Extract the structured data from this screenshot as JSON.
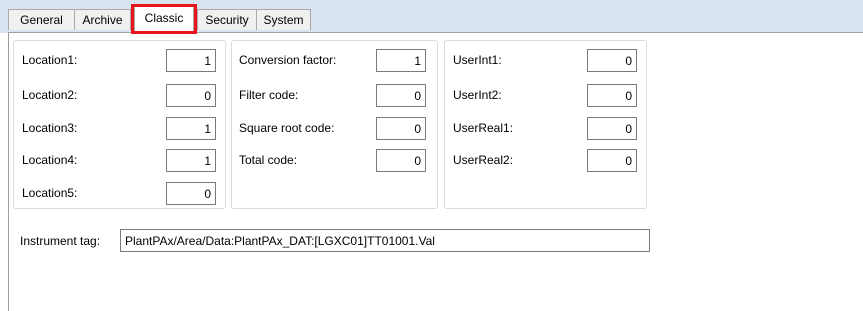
{
  "tabs": [
    {
      "label": "General"
    },
    {
      "label": "Archive"
    },
    {
      "label": "Classic"
    },
    {
      "label": "Security"
    },
    {
      "label": "System"
    }
  ],
  "active_tab": "Classic",
  "highlight_color": "#e8141c",
  "locations": [
    {
      "label": "Location1:",
      "value": "1"
    },
    {
      "label": "Location2:",
      "value": "0"
    },
    {
      "label": "Location3:",
      "value": "1"
    },
    {
      "label": "Location4:",
      "value": "1"
    },
    {
      "label": "Location5:",
      "value": "0"
    }
  ],
  "codes": [
    {
      "label": "Conversion factor:",
      "value": "1"
    },
    {
      "label": "Filter code:",
      "value": "0"
    },
    {
      "label": "Square root code:",
      "value": "0"
    },
    {
      "label": "Total code:",
      "value": "0"
    }
  ],
  "user": [
    {
      "label": "UserInt1:",
      "value": "0"
    },
    {
      "label": "UserInt2:",
      "value": "0"
    },
    {
      "label": "UserReal1:",
      "value": "0"
    },
    {
      "label": "UserReal2:",
      "value": "0"
    }
  ],
  "instrument": {
    "label": "Instrument tag:",
    "value": "PlantPAx/Area/Data:PlantPAx_DAT:[LGXC01]TT01001.Val"
  }
}
